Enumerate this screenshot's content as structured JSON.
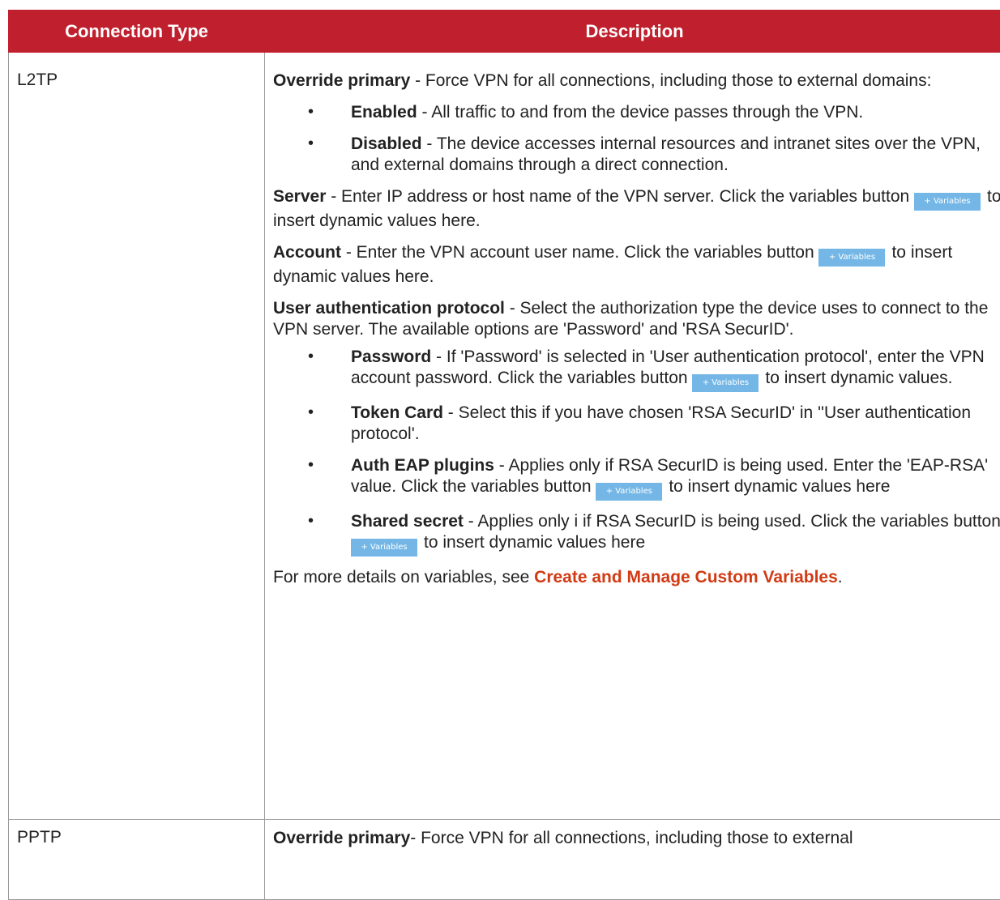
{
  "header": {
    "col_type": "Connection Type",
    "col_desc": "Description"
  },
  "l2tp": {
    "type": "L2TP",
    "override": {
      "label": "Override primary",
      "text": " - Force VPN for all connections, including those to external domains:"
    },
    "enabled": {
      "label": "Enabled",
      "text": " - All traffic to and from the device passes through the VPN."
    },
    "disabled": {
      "label": "Disabled",
      "text": " - The device accesses internal resources and intranet sites over the VPN, and external domains through a direct connection."
    },
    "server": {
      "label": "Server",
      "text_before": " - Enter IP address or host name of the VPN server. Click the variables button ",
      "text_after": "to insert dynamic values here."
    },
    "account": {
      "label": "Account",
      "text_before": " - Enter the VPN account user name. Click the variables button ",
      "text_after": "to insert dynamic values here."
    },
    "auth": {
      "label": "User authentication protocol",
      "text": " - Select the authorization type the device uses to connect to the VPN server. The available options are 'Password' and 'RSA SecurID'."
    },
    "password": {
      "label": "Password",
      "text_before": " - If 'Password' is selected in 'User authentication protocol', enter the VPN account password. Click the variables button ",
      "text_after": "to insert dynamic values."
    },
    "token": {
      "label": "Token Card",
      "text": " - Select this if you have chosen 'RSA SecurID' in ''User authentication protocol'."
    },
    "eap": {
      "label": "Auth EAP plugins",
      "text_before": " - Applies only if RSA SecurID is being used. Enter the 'EAP-RSA' value. Click the variables button ",
      "text_after": "to insert dynamic values here"
    },
    "secret": {
      "label": "Shared secret",
      "text_before": " - Applies only i if RSA SecurID is being used. Click the variables button ",
      "text_after": "to insert dynamic values here"
    },
    "more": {
      "text_before": "For more details on variables, see ",
      "link": "Create and Manage Custom Variables",
      "text_after": "."
    }
  },
  "pptp": {
    "type": "PPTP",
    "override": {
      "label": "Override primary",
      "text": "- Force VPN for all connections, including those to external"
    }
  },
  "variables_button_label": "+ Variables",
  "bullet_char": "•",
  "colors": {
    "header_bg": "#c0202e",
    "button_bg": "#74b7e6",
    "link": "#d23a14"
  }
}
